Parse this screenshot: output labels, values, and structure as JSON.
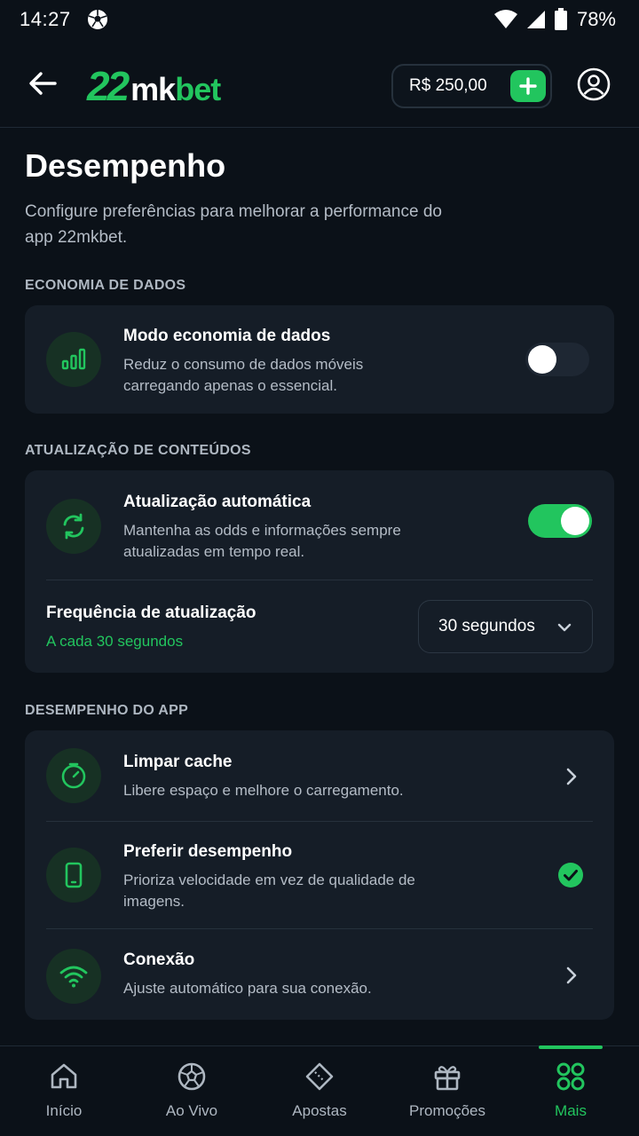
{
  "status_bar": {
    "time": "14:27",
    "battery": "78%"
  },
  "header": {
    "logo_num": "22",
    "logo_mk": "mk",
    "logo_bet": "bet",
    "balance": "R$ 250,00"
  },
  "page": {
    "title": "Desempenho",
    "subtitle": "Configure preferências para melhorar a performance do app 22mkbet."
  },
  "sections": {
    "data_saving": {
      "label": "ECONOMIA DE DADOS",
      "title": "Modo economia de dados",
      "desc": "Reduz o consumo de dados móveis carregando apenas o essencial.",
      "enabled": false
    },
    "content_update": {
      "label": "ATUALIZAÇÃO DE CONTEÚDOS",
      "title": "Atualização automática",
      "desc": "Mantenha as odds e informações sempre atualizadas em tempo real.",
      "enabled": true,
      "frequency_title": "Frequência de atualização",
      "frequency_value_text": "A cada 30 segundos",
      "frequency_selected": "30 segundos"
    },
    "app_performance": {
      "label": "DESEMPENHO DO APP",
      "items": [
        {
          "title": "Limpar cache",
          "desc": "Libere espaço e melhore o carregamento.",
          "icon": "gauge-icon",
          "trailing": "chevron-right-icon"
        },
        {
          "title": "Preferir desempenho",
          "desc": "Prioriza velocidade em vez de qualidade de imagens.",
          "icon": "smartphone-icon",
          "trailing": "check-circle-icon"
        },
        {
          "title": "Conexão",
          "desc": "Ajuste automático para sua conexão.",
          "icon": "wifi-icon",
          "trailing": "chevron-right-icon"
        }
      ]
    }
  },
  "bottom_nav": [
    {
      "label": "Início",
      "icon": "home-icon",
      "active": false
    },
    {
      "label": "Ao Vivo",
      "icon": "live-ball-icon",
      "active": false
    },
    {
      "label": "Apostas",
      "icon": "ticket-icon",
      "active": false
    },
    {
      "label": "Promoções",
      "icon": "gift-icon",
      "active": false
    },
    {
      "label": "Mais",
      "icon": "grid-icon",
      "active": true
    }
  ],
  "colors": {
    "accent": "#22c55e",
    "background": "#0b1118",
    "card": "#151d27",
    "muted_text": "#b4bcc6"
  }
}
